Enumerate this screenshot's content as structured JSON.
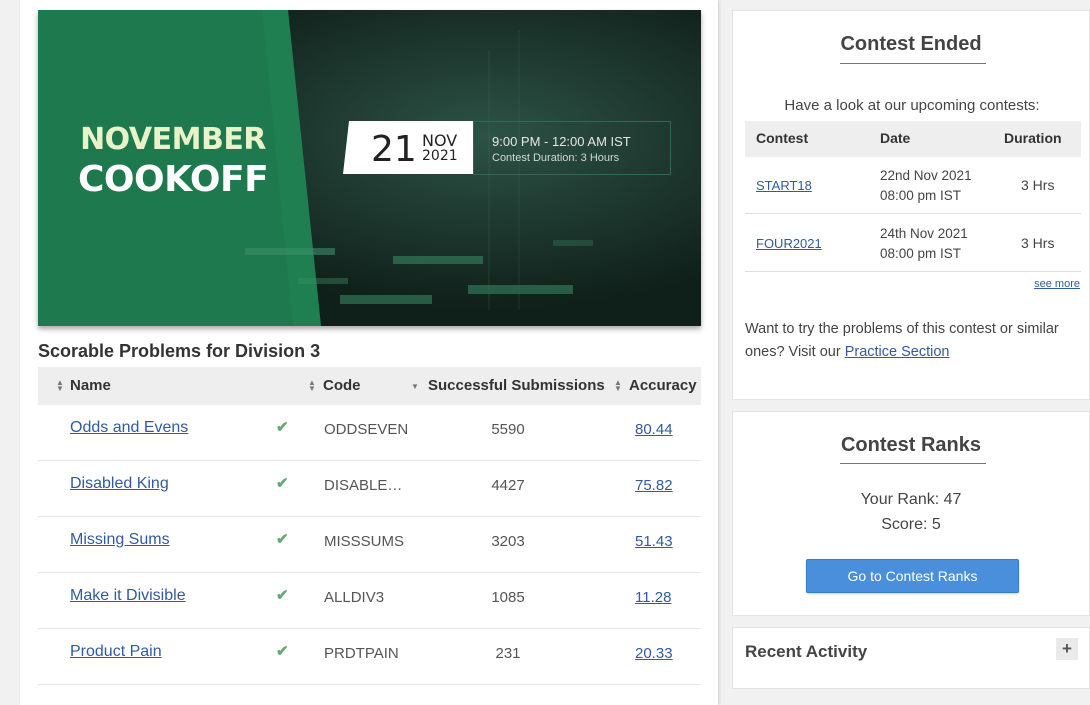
{
  "banner": {
    "title_line1": "NOVEMBER",
    "title_line2": "COOKOFF",
    "day": "21",
    "month": "NOV",
    "year": "2021",
    "time": "9:00 PM - 12:00 AM IST",
    "duration": "Contest Duration: 3 Hours",
    "colors": {
      "green": "#1e7a4e",
      "dark": "#152a22"
    }
  },
  "problems": {
    "title": "Scorable Problems for Division 3",
    "headers": {
      "name": "Name",
      "code": "Code",
      "subs": "Successful Submissions",
      "acc": "Accuracy"
    },
    "check_icon": "✔",
    "rows": [
      {
        "name": "Odds and Evens",
        "code": "ODDSEVEN",
        "subs": "5590",
        "acc": "80.44"
      },
      {
        "name": "Disabled King",
        "code": "DISABLEDKING",
        "subs": "4427",
        "acc": "75.82"
      },
      {
        "name": "Missing Sums",
        "code": "MISSSUMS",
        "subs": "3203",
        "acc": "51.43"
      },
      {
        "name": "Make it Divisible",
        "code": "ALLDIV3",
        "subs": "1085",
        "acc": "11.28"
      },
      {
        "name": "Product Pain",
        "code": "PRDTPAIN",
        "subs": "231",
        "acc": "20.33"
      }
    ]
  },
  "contest_ended": {
    "title": "Contest Ended",
    "subtitle": "Have a look at our upcoming contests:",
    "headers": {
      "contest": "Contest",
      "date": "Date",
      "duration": "Duration"
    },
    "rows": [
      {
        "code": "START18",
        "date1": "22nd Nov 2021",
        "date2": "08:00 pm IST",
        "duration": "3 Hrs"
      },
      {
        "code": "FOUR2021",
        "date1": "24th Nov 2021",
        "date2": "08:00 pm IST",
        "duration": "3 Hrs"
      }
    ],
    "see_more": "see more",
    "practice_text": "Want to try the problems of this contest or similar ones? Visit our",
    "practice_link": "Practice Section"
  },
  "ranks": {
    "title": "Contest Ranks",
    "rank": "Your Rank: 47",
    "score": "Score: 5",
    "button": "Go to Contest Ranks"
  },
  "recent": {
    "title": "Recent Activity",
    "plus": "+"
  }
}
